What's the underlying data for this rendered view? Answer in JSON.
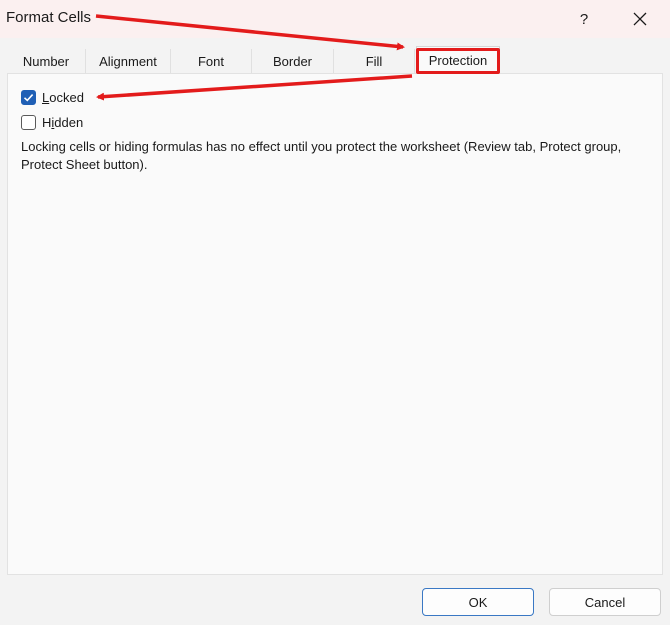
{
  "window": {
    "title": "Format Cells",
    "help_label": "?"
  },
  "tabs": [
    {
      "label": "Number",
      "active": false
    },
    {
      "label": "Alignment",
      "active": false
    },
    {
      "label": "Font",
      "active": false
    },
    {
      "label": "Border",
      "active": false
    },
    {
      "label": "Fill",
      "active": false
    },
    {
      "label": "Protection",
      "active": true
    }
  ],
  "protection": {
    "locked": {
      "label_prefix": "",
      "label_access_key": "L",
      "label_rest": "ocked",
      "checked": true
    },
    "hidden": {
      "label_prefix": "H",
      "label_access_key": "i",
      "label_rest": "dden",
      "checked": false
    },
    "description": "Locking cells or hiding formulas has no effect until you protect the worksheet (Review tab, Protect group, Protect Sheet button)."
  },
  "buttons": {
    "ok": "OK",
    "cancel": "Cancel"
  },
  "colors": {
    "annotation": "#e31b1b",
    "checkbox_checked": "#1f5fb5",
    "ok_border": "#3a78c4"
  },
  "icons": {
    "close": "close-icon",
    "check": "checkmark-icon"
  }
}
